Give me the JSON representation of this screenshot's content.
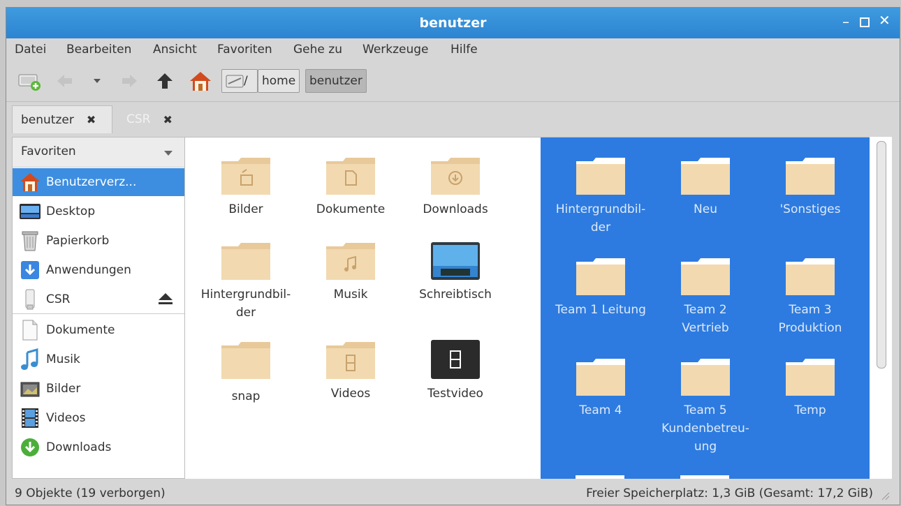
{
  "window": {
    "title": "benutzer"
  },
  "menu": [
    "Datei",
    "Bearbeiten",
    "Ansicht",
    "Favoriten",
    "Gehe zu",
    "Werkzeuge",
    "Hilfe"
  ],
  "path": {
    "root": "/",
    "segments": [
      "home",
      "benutzer"
    ]
  },
  "tabs": [
    {
      "label": "benutzer",
      "close": "✖"
    },
    {
      "label": "CSR",
      "close": "✖"
    }
  ],
  "sidebar": {
    "header": "Favoriten",
    "items": [
      {
        "label": "Benutzerverz...",
        "icon": "home-icon"
      },
      {
        "label": "Desktop",
        "icon": "desktop-icon"
      },
      {
        "label": "Papierkorb",
        "icon": "trash-icon"
      },
      {
        "label": "Anwendungen",
        "icon": "applications-icon"
      },
      {
        "label": "CSR",
        "icon": "usb-drive-icon"
      },
      {
        "label": "Dokumente",
        "icon": "document-icon"
      },
      {
        "label": "Musik",
        "icon": "music-icon"
      },
      {
        "label": "Bilder",
        "icon": "pictures-icon"
      },
      {
        "label": "Videos",
        "icon": "videos-icon"
      },
      {
        "label": "Downloads",
        "icon": "downloads-icon"
      }
    ]
  },
  "files": [
    {
      "name": "Bilder",
      "icon": "folder-pictures-icon"
    },
    {
      "name": "Dokumente",
      "icon": "folder-documents-icon"
    },
    {
      "name": "Downloads",
      "icon": "folder-downloads-icon"
    },
    {
      "name": "Hintergrundbil-der",
      "line1": "Hintergrundbil-",
      "line2": "der",
      "icon": "folder-icon"
    },
    {
      "name": "Musik",
      "icon": "folder-music-icon"
    },
    {
      "name": "Schreibtisch",
      "icon": "folder-desktop-icon"
    },
    {
      "name": "snap",
      "icon": "folder-icon"
    },
    {
      "name": "Videos",
      "icon": "folder-videos-icon"
    },
    {
      "name": "Testvideo",
      "icon": "video-file-icon"
    }
  ],
  "selected_files": [
    {
      "line1": "Hintergrundbil-",
      "line2": "der"
    },
    {
      "line1": "Neu",
      "line2": ""
    },
    {
      "line1": "'Sonstiges",
      "line2": ""
    },
    {
      "line1": "Team 1 Leitung",
      "line2": ""
    },
    {
      "line1": "Team 2",
      "line2": "Vertrieb"
    },
    {
      "line1": "Team 3",
      "line2": "Produktion"
    },
    {
      "line1": "Team 4",
      "line2": ""
    },
    {
      "line1": "Team 5",
      "line2": "Kundenbetreu-",
      "line3": "ung"
    },
    {
      "line1": "Temp",
      "line2": ""
    }
  ],
  "status": {
    "left": "9 Objekte (19 verborgen)",
    "right": "Freier Speicherplatz: 1,3 GiB (Gesamt: 17,2 GiB)"
  },
  "colors": {
    "titlebar": "#2c84d2",
    "selection": "#2d7be0",
    "folder": "#f2d9b0"
  }
}
